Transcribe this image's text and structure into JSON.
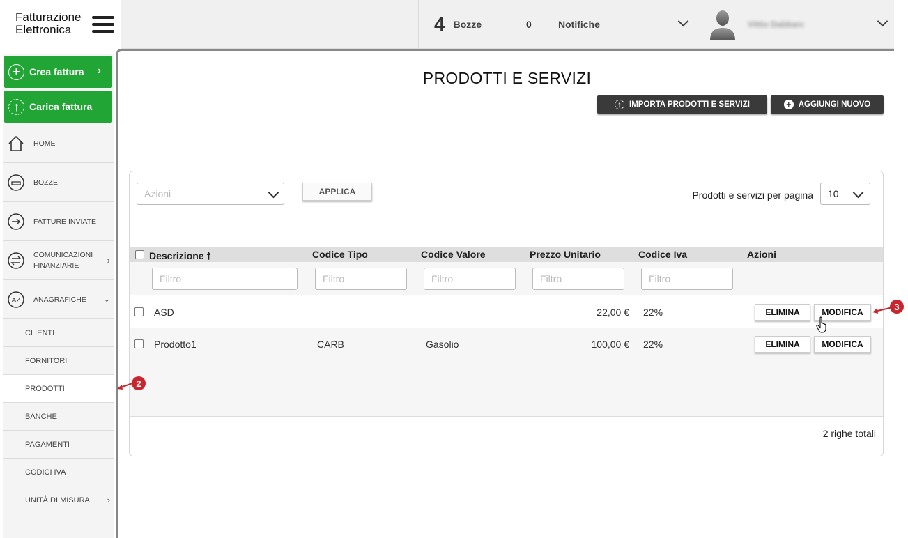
{
  "header": {
    "logo_line1": "Fatturazione",
    "logo_line2": "Elettronica",
    "bozze_count": "4",
    "bozze_label": "Bozze",
    "notifiche_count": "0",
    "notifiche_label": "Notifiche",
    "user_name": "Vittio Dabbarc"
  },
  "sidebar": {
    "crea_fattura": "Crea fattura",
    "carica_fattura": "Carica fattura",
    "items": [
      {
        "label": "HOME"
      },
      {
        "label": "BOZZE"
      },
      {
        "label": "FATTURE INVIATE"
      },
      {
        "label": "COMUNICAZIONI FINANZIARIE"
      },
      {
        "label": "ANAGRAFICHE"
      }
    ],
    "subitems": [
      {
        "label": "CLIENTI"
      },
      {
        "label": "FORNITORI"
      },
      {
        "label": "PRODOTTI"
      },
      {
        "label": "BANCHE"
      },
      {
        "label": "PAGAMENTI"
      },
      {
        "label": "CODICI IVA"
      },
      {
        "label": "UNITÀ DI MISURA"
      }
    ]
  },
  "main": {
    "title": "PRODOTTI E SERVIZI",
    "import_button": "IMPORTA PRODOTTI E SERVIZI",
    "add_button": "AGGIUNGI NUOVO",
    "actions_placeholder": "Azioni",
    "apply_button": "APPLICA",
    "per_page_label": "Prodotti e servizi per pagina",
    "per_page_value": "10",
    "columns": [
      "Descrizione",
      "Codice Tipo",
      "Codice Valore",
      "Prezzo Unitario",
      "Codice Iva",
      "Azioni"
    ],
    "filter_placeholder": "Filtro",
    "rows": [
      {
        "descrizione": "ASD",
        "codice_tipo": "",
        "codice_valore": "",
        "prezzo": "22,00 €",
        "iva": "22%",
        "elimina": "ELIMINA",
        "modifica": "MODIFICA"
      },
      {
        "descrizione": "Prodotto1",
        "codice_tipo": "CARB",
        "codice_valore": "Gasolio",
        "prezzo": "100,00 €",
        "iva": "22%",
        "elimina": "ELIMINA",
        "modifica": "MODIFICA"
      }
    ],
    "totals": "2 righe totali"
  },
  "annotations": {
    "marker_2": "2",
    "marker_3": "3"
  },
  "colors": {
    "green": "#21a534",
    "dark_button": "#3a3a3a",
    "marker_red": "#c7262e"
  }
}
